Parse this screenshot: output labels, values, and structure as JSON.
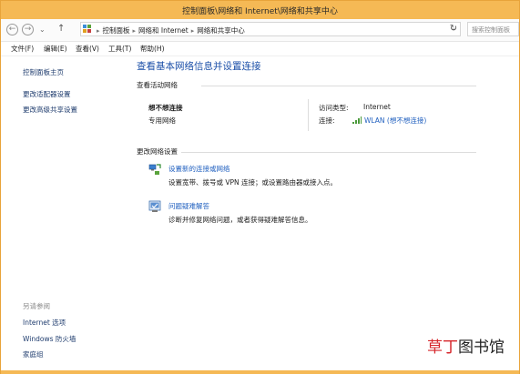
{
  "window": {
    "title": "控制面板\\网络和 Internet\\网络和共享中心"
  },
  "address": {
    "crumbs": [
      "控制面板",
      "网络和 Internet",
      "网络和共享中心"
    ],
    "search_placeholder": "搜索控制面板"
  },
  "menu": {
    "items": [
      "文件(F)",
      "编辑(E)",
      "查看(V)",
      "工具(T)",
      "帮助(H)"
    ]
  },
  "sidebar": {
    "links": [
      "控制面板主页",
      "更改适配器设置",
      "更改高级共享设置"
    ],
    "see_also_heading": "另请参阅",
    "see_also": [
      "Internet 选项",
      "Windows 防火墙",
      "家庭组"
    ]
  },
  "main": {
    "title": "查看基本网络信息并设置连接",
    "active_networks_heading": "查看活动网络",
    "network": {
      "name": "想不想连接",
      "profile": "专用网络",
      "access_type_label": "访问类型:",
      "access_type_value": "Internet",
      "connections_label": "连接:",
      "connections_value": "WLAN (想不想连接)"
    },
    "change_settings_heading": "更改网络设置",
    "tasks": [
      {
        "icon": "network-setup-icon",
        "link": "设置新的连接或网络",
        "desc": "设置宽带、拨号或 VPN 连接；或设置路由器或接入点。"
      },
      {
        "icon": "troubleshoot-icon",
        "link": "问题疑难解答",
        "desc": "诊断并修复网络问题，或者获得疑难解答信息。"
      }
    ]
  },
  "watermark": {
    "red_part": "草丁",
    "black_part": "图书馆"
  },
  "colors": {
    "titlebar": "#f5b955",
    "link": "#1f5fbf",
    "title_link": "#1b4fa8"
  }
}
